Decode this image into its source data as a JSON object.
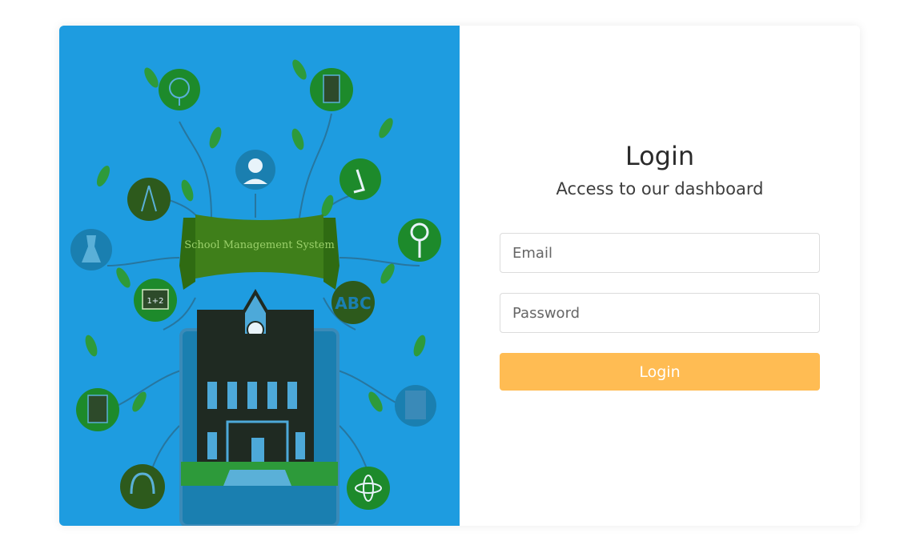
{
  "illustration": {
    "banner_text": "School Management System",
    "abc_text": "ABC",
    "board_text": "1+2",
    "colors": {
      "background": "#1e9ce0",
      "circle_green": "#1d8a2b",
      "circle_dark": "#2d5a1c",
      "leaf": "#2e9a3a",
      "banner": "#2f6b12",
      "building": "#1f2a22"
    }
  },
  "login": {
    "title": "Login",
    "subtitle": "Access to our dashboard",
    "email_placeholder": "Email",
    "password_placeholder": "Password",
    "button_label": "Login",
    "button_color": "#ffbc53"
  }
}
